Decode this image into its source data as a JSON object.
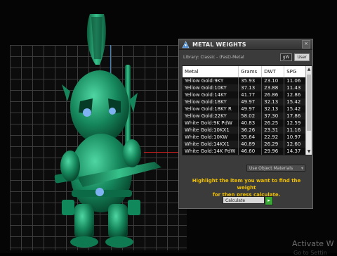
{
  "window": {
    "title": "METAL WEIGHTS",
    "close_label": "×"
  },
  "library": {
    "label": "Library: Classic - (Fast)-Metal",
    "toggle_a": "gW",
    "toggle_b": "User"
  },
  "table": {
    "headers": [
      "Metal",
      "Grams",
      "DWT",
      "SPG"
    ],
    "rows": [
      [
        "Yellow Gold:9KY",
        "35.93",
        "23.10",
        "11.06"
      ],
      [
        "Yellow Gold:10KY",
        "37.13",
        "23.88",
        "11.43"
      ],
      [
        "Yellow Gold:14KY",
        "41.77",
        "26.86",
        "12.86"
      ],
      [
        "Yellow Gold:18KY",
        "49.97",
        "32.13",
        "15.42"
      ],
      [
        "Yellow Gold:18KY R",
        "49.97",
        "32.13",
        "15.42"
      ],
      [
        "Yellow Gold:22KY",
        "58.02",
        "37.30",
        "17.86"
      ],
      [
        "White Gold:9K PdW",
        "40.83",
        "26.25",
        "12.59"
      ],
      [
        "White Gold:10KX1",
        "36.26",
        "23.31",
        "11.16"
      ],
      [
        "White Gold:10KW",
        "35.64",
        "22.92",
        "10.97"
      ],
      [
        "White Gold:14KX1",
        "40.89",
        "26.29",
        "12.60"
      ],
      [
        "White Gold:14K PdW",
        "46.60",
        "29.96",
        "14.37"
      ]
    ]
  },
  "options": {
    "material_select": "Use Object Materials"
  },
  "hint": {
    "line1": "Highlight the item you want to find the weight",
    "line2": "for then press calculate."
  },
  "calculate": {
    "label": "Calculate",
    "go": "▸"
  },
  "watermark": {
    "line1": "Activate W",
    "line2": "Go to Settin"
  },
  "colors": {
    "model_green": "#1f9a6e",
    "hint_yellow": "#f0c000",
    "dialog_bg": "#3b3b3b",
    "go_green": "#3aa636"
  }
}
